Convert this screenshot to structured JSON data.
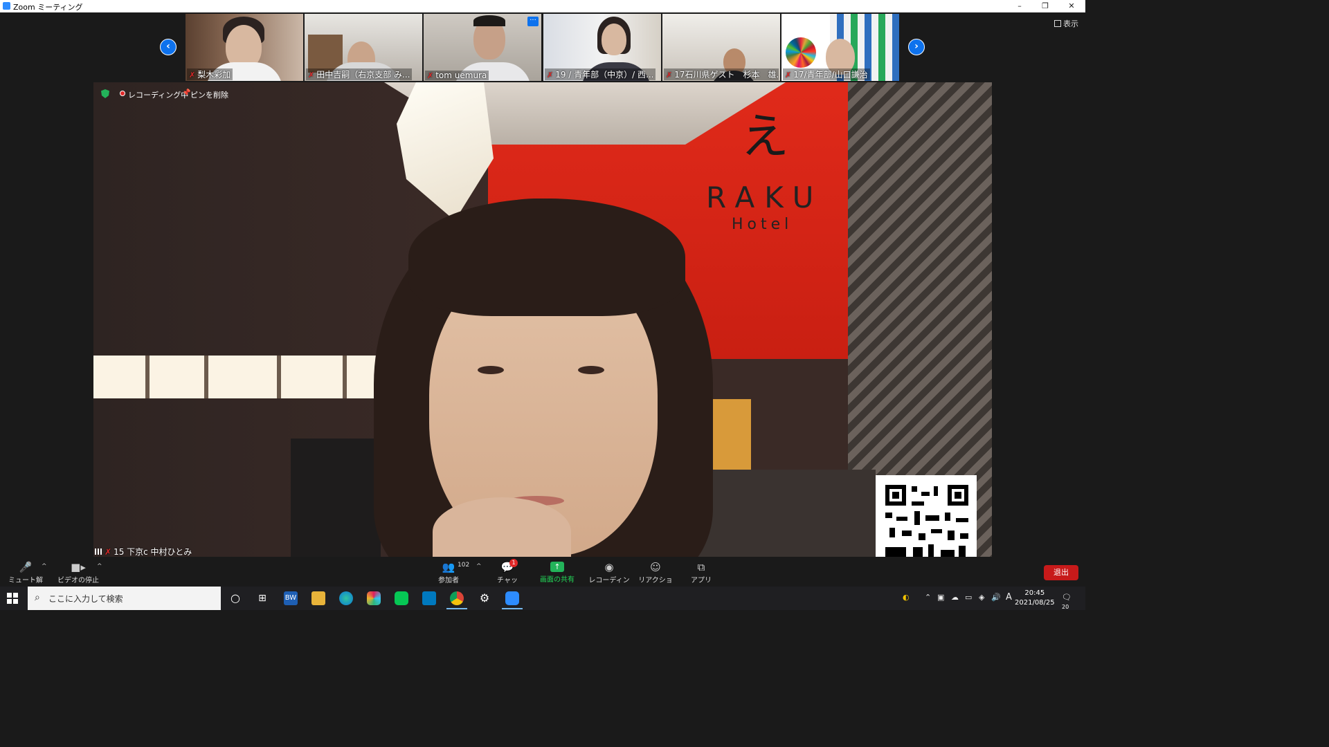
{
  "window": {
    "title": "Zoom ミーティング",
    "minimize": "–",
    "restore": "❐",
    "close": "✕"
  },
  "view_button": {
    "label": "表示",
    "icon": "grid-icon"
  },
  "strip": {
    "prev_icon": "chevron-left-icon",
    "next_icon": "chevron-right-icon",
    "prev_glyph": "‹",
    "next_glyph": "›",
    "participants": [
      {
        "name": "梨木彩加",
        "muted": true
      },
      {
        "name": "田中吉嗣（右京支部 み...",
        "muted": true
      },
      {
        "name": "tom uemura",
        "muted": true,
        "has_more": true
      },
      {
        "name": "19 / 青年部（中京）/ 西...",
        "muted": true
      },
      {
        "name": "17石川県ゲスト　杉本　雄...",
        "muted": true
      },
      {
        "name": "17/青年部/山口謙治",
        "muted": true
      }
    ],
    "more_glyph": "···"
  },
  "main_video": {
    "status": {
      "recording_label": "レコーディング中",
      "unpin_label": "ピンを削除"
    },
    "speaker_label": "15 下京c 中村ひとみ",
    "background_brand": "RAKU",
    "background_brand_sub": "Hotel"
  },
  "controls": {
    "mute": {
      "label": "ミュート解除",
      "icon": "muted-mic-icon"
    },
    "video": {
      "label": "ビデオの停止",
      "icon": "video-camera-icon"
    },
    "participants": {
      "label": "参加者",
      "count": "102",
      "icon": "participants-icon"
    },
    "chat": {
      "label": "チャット",
      "badge": "1",
      "icon": "chat-icon"
    },
    "share": {
      "label": "画面の共有",
      "icon": "share-screen-icon"
    },
    "record": {
      "label": "レコーディング",
      "icon": "record-icon"
    },
    "reactions": {
      "label": "リアクション",
      "icon": "reaction-icon"
    },
    "apps": {
      "label": "アプリ",
      "icon": "apps-icon"
    },
    "leave": {
      "label": "退出"
    },
    "caret": "^"
  },
  "taskbar": {
    "search_placeholder": "ここに入力して検索",
    "time": "20:45",
    "date": "2021/08/25",
    "ime": "A",
    "notification_count": "20",
    "app_bw_label": "BW"
  },
  "colors": {
    "zoom_blue": "#0e72ed",
    "share_green": "#23b35a",
    "leave_red": "#c71a1a",
    "mute_red": "#e02828"
  }
}
